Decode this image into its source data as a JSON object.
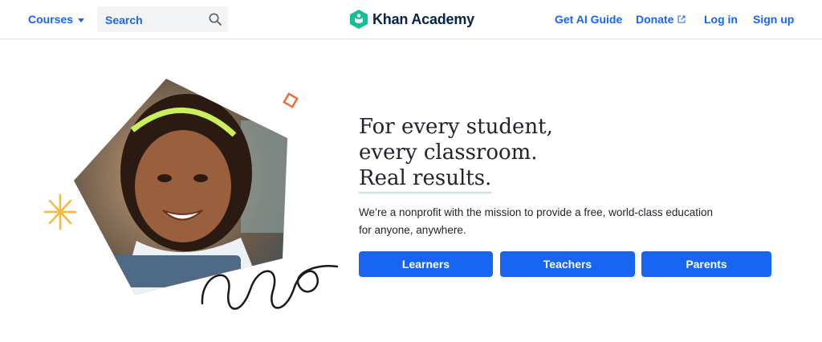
{
  "header": {
    "courses_label": "Courses",
    "search_placeholder": "Search",
    "logo_text": "Khan Academy",
    "nav": {
      "ai_guide": "Get AI Guide",
      "donate": "Donate",
      "login": "Log in",
      "signup": "Sign up"
    }
  },
  "hero": {
    "headline": [
      "For every student,",
      "every classroom.",
      "Real results."
    ],
    "subtext_line1": "We’re a nonprofit with the mission to provide a free, world-class education",
    "subtext_line2": "for anyone, anywhere.",
    "buttons": {
      "learners": "Learners",
      "teachers": "Teachers",
      "parents": "Parents"
    }
  },
  "colors": {
    "accent": "#1865f2",
    "logo_green": "#14bf96",
    "headline": "#21242c"
  },
  "icons": [
    "chevron-down-icon",
    "search-icon",
    "khan-logo-icon",
    "external-link-icon"
  ]
}
